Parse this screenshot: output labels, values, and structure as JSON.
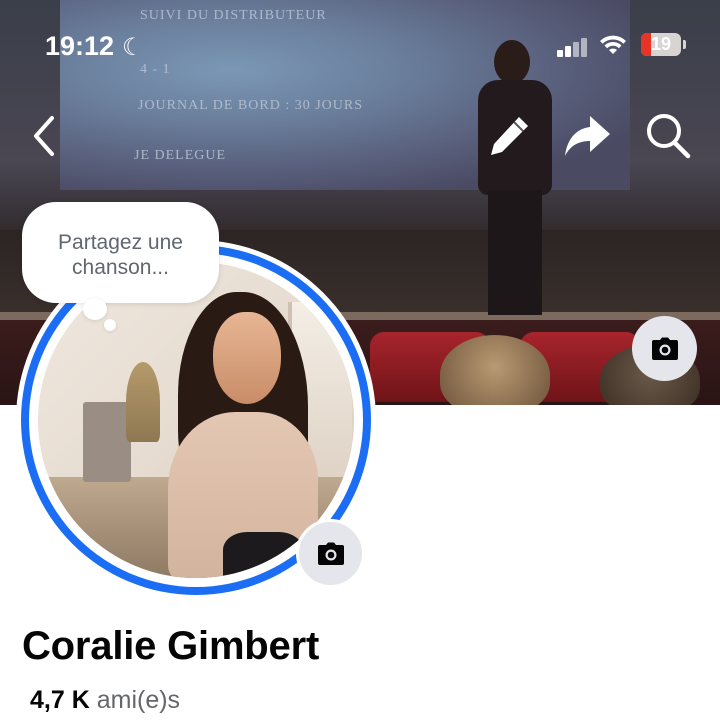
{
  "status_bar": {
    "time": "19:12",
    "battery": "19",
    "icons": [
      "moon-icon",
      "cellular-signal-icon",
      "wifi-icon",
      "battery-icon"
    ]
  },
  "cover": {
    "screen_lines": [
      "SUIVI DU DISTRIBUTEUR",
      "4 - 1",
      "JOURNAL DE BORD : 30 JOURS",
      "JE DELEGUE"
    ]
  },
  "nav": {
    "icons": [
      "back-chevron-icon",
      "edit-pencil-icon",
      "share-arrow-icon",
      "search-icon"
    ]
  },
  "note_bubble": {
    "text": "Partagez une chanson..."
  },
  "profile": {
    "name": "Coralie Gimbert",
    "friends_count": "4,7 K",
    "friends_label": "ami(e)s"
  },
  "colors": {
    "ring_blue": "#1b6ef3",
    "battery_red": "#e73426",
    "button_bg": "#e5e6eb",
    "text_dark": "#050505",
    "text_gray": "#65676b"
  }
}
